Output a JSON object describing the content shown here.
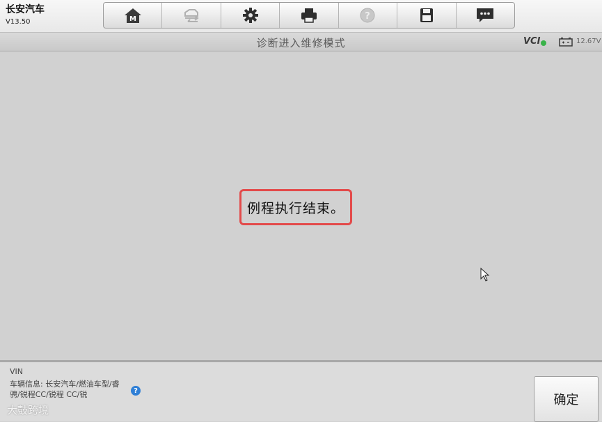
{
  "app": {
    "title": "长安汽车",
    "version": "V13.50"
  },
  "toolbar": {
    "buttons": [
      {
        "icon": "home-icon",
        "enabled": true
      },
      {
        "icon": "vehicle-swap-icon",
        "enabled": false
      },
      {
        "icon": "gear-icon",
        "enabled": true
      },
      {
        "icon": "printer-icon",
        "enabled": true
      },
      {
        "icon": "help-icon",
        "enabled": false
      },
      {
        "icon": "save-icon",
        "enabled": true
      },
      {
        "icon": "message-icon",
        "enabled": true
      }
    ]
  },
  "header": {
    "title": "诊断进入维修模式",
    "vci_label": "VCI",
    "voltage": "12.67V"
  },
  "main": {
    "message": "例程执行结束。"
  },
  "footer": {
    "vin_label": "VIN",
    "vehicle_info": "车辆信息: 长安汽车/燃油车型/睿骋/锐程CC/锐程 CC/锐",
    "watermark": "大鼓跨境",
    "confirm_label": "确定"
  },
  "colors": {
    "highlight_border": "#e34a4a",
    "vci_status": "#3ab34a",
    "help_badge": "#2f7fd6"
  }
}
